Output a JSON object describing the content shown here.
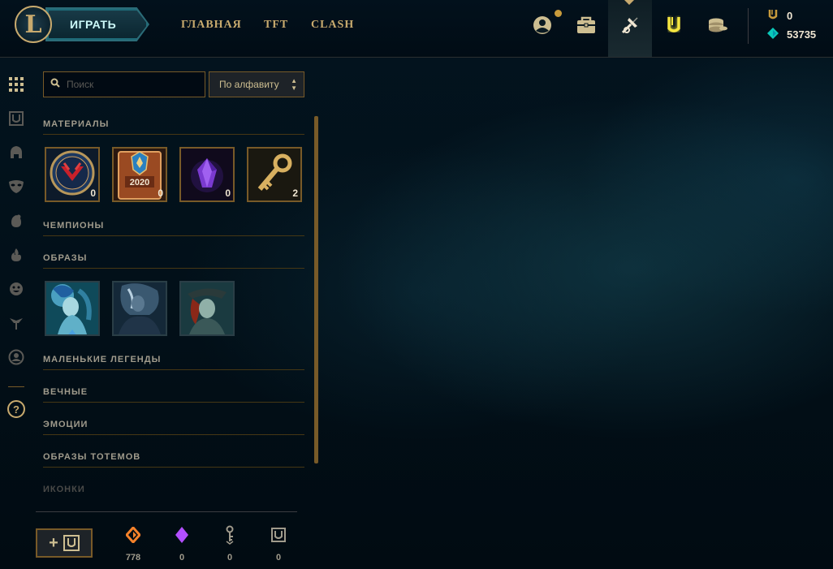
{
  "nav": {
    "play_label": "ИГРАТЬ",
    "links": [
      "ГЛАВНАЯ",
      "TFT",
      "CLASH"
    ],
    "icons": [
      "profile-icon",
      "collection-icon",
      "loot-icon",
      "store-icon",
      "currency-icon"
    ]
  },
  "wallet": {
    "riot_points": "0",
    "blue_essence": "53735"
  },
  "search": {
    "placeholder": "Поиск",
    "value": ""
  },
  "sort": {
    "selected": "По алфавиту"
  },
  "sections": {
    "materials": "МАТЕРИАЛЫ",
    "champions": "ЧЕМПИОНЫ",
    "skins": "ОБРАЗЫ",
    "little_legends": "МАЛЕНЬКИЕ ЛЕГЕНДЫ",
    "eternals": "ВЕЧНЫЕ",
    "emotes": "ЭМОЦИИ",
    "ward_skins": "ОБРАЗЫ ТОТЕМОВ",
    "icons": "ИКОНКИ"
  },
  "materials": [
    {
      "icon": "worlds-orb-icon",
      "count": "0"
    },
    {
      "icon": "2020-capsule-icon",
      "count": "0"
    },
    {
      "icon": "mythic-essence-icon",
      "count": "0"
    },
    {
      "icon": "key-fragment-icon",
      "count": "2"
    }
  ],
  "materials_extra": {
    "capsule_text": "2020"
  },
  "skins": [
    {
      "icon": "skin-shard-1-icon"
    },
    {
      "icon": "skin-shard-2-icon"
    },
    {
      "icon": "skin-shard-3-icon"
    }
  ],
  "footer": {
    "craft_label": "+",
    "currencies": [
      {
        "icon": "orange-essence-icon",
        "value": "778",
        "color": "#f5822a"
      },
      {
        "icon": "mythic-essence-icon",
        "value": "0",
        "color": "#b24fff"
      },
      {
        "icon": "key-icon",
        "value": "0",
        "color": "#a09b8c"
      },
      {
        "icon": "chest-icon",
        "value": "0",
        "color": "#a09b8c"
      }
    ]
  },
  "colors": {
    "gold": "#c8aa6e",
    "dark_gold": "#785a28",
    "teal": "#0ac8b9",
    "background": "#010a13"
  }
}
